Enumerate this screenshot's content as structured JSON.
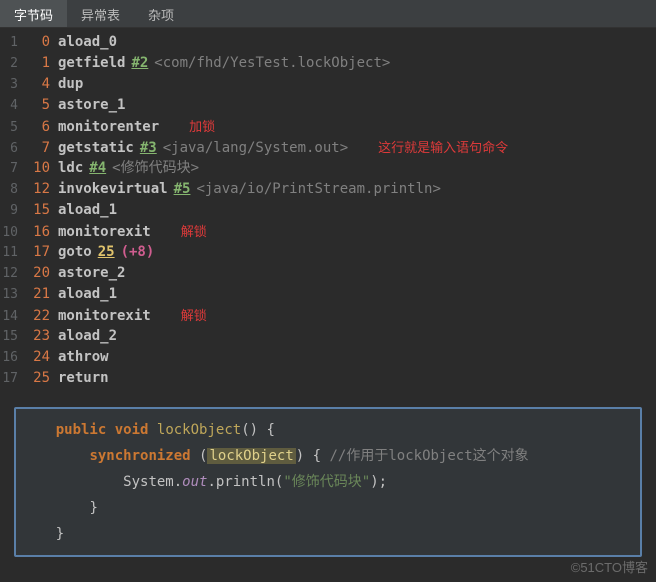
{
  "tabs": [
    "字节码",
    "异常表",
    "杂项"
  ],
  "bytecode": [
    {
      "n": "1",
      "off": "0",
      "op": "aload_0"
    },
    {
      "n": "2",
      "off": "1",
      "op": "getfield",
      "ref": "#2",
      "desc": "<com/fhd/YesTest.lockObject>"
    },
    {
      "n": "3",
      "off": "4",
      "op": "dup"
    },
    {
      "n": "4",
      "off": "5",
      "op": "astore_1"
    },
    {
      "n": "5",
      "off": "6",
      "op": "monitorenter",
      "anno": "加锁"
    },
    {
      "n": "6",
      "off": "7",
      "op": "getstatic",
      "ref": "#3",
      "desc": "<java/lang/System.out>",
      "anno": "这行就是输入语句命令"
    },
    {
      "n": "7",
      "off": "10",
      "op": "ldc",
      "ref": "#4",
      "desc": "<修饰代码块>"
    },
    {
      "n": "8",
      "off": "12",
      "op": "invokevirtual",
      "ref": "#5",
      "desc": "<java/io/PrintStream.println>"
    },
    {
      "n": "9",
      "off": "15",
      "op": "aload_1"
    },
    {
      "n": "10",
      "off": "16",
      "op": "monitorexit",
      "anno": "解锁"
    },
    {
      "n": "11",
      "off": "17",
      "op": "goto",
      "target": "25",
      "rel": "(+8)"
    },
    {
      "n": "12",
      "off": "20",
      "op": "astore_2"
    },
    {
      "n": "13",
      "off": "21",
      "op": "aload_1"
    },
    {
      "n": "14",
      "off": "22",
      "op": "monitorexit",
      "anno": "解锁"
    },
    {
      "n": "15",
      "off": "23",
      "op": "aload_2"
    },
    {
      "n": "16",
      "off": "24",
      "op": "athrow"
    },
    {
      "n": "17",
      "off": "25",
      "op": "return"
    }
  ],
  "source": {
    "kw_public": "public",
    "kw_void": "void",
    "kw_sync": "synchronized",
    "method": "lockObject",
    "hl": "lockObject",
    "comment": "//作用于lockObject这个对象",
    "sys": "System.",
    "out": "out",
    "println": ".println(",
    "str": "\"修饰代码块\"",
    "end": ");",
    "lbrace": "{",
    "rbrace": "}",
    "paren_l": "(",
    "paren_r": ")",
    "space_lbrace": " {"
  },
  "watermark": "©51CTO博客"
}
